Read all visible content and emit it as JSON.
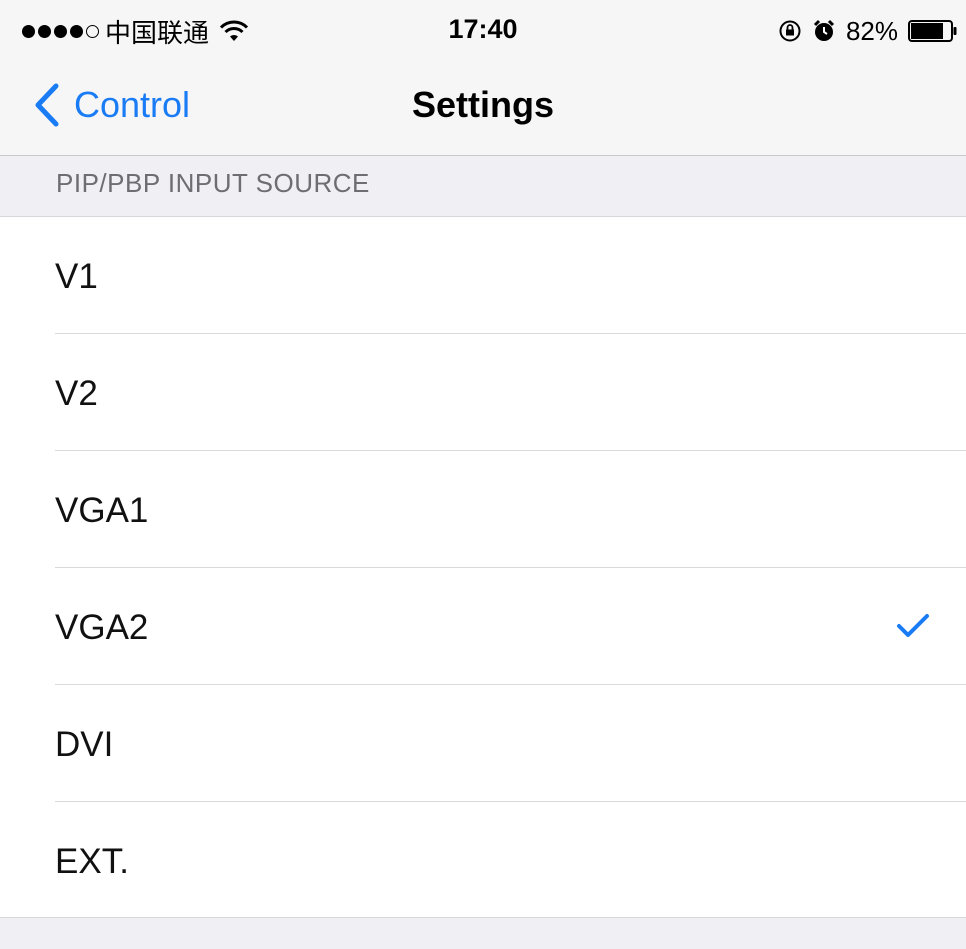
{
  "status_bar": {
    "signal_icon": "signal-dots-icon",
    "carrier": "中国联通",
    "wifi_icon": "wifi-icon",
    "time": "17:40",
    "rotation_lock_icon": "rotation-lock-icon",
    "alarm_icon": "alarm-icon",
    "battery_percent": "82%",
    "battery_icon": "battery-icon"
  },
  "navbar": {
    "back_label": "Control",
    "title": "Settings"
  },
  "section": {
    "header": "PIP/PBP INPUT SOURCE"
  },
  "options": [
    {
      "label": "V1",
      "selected": false
    },
    {
      "label": "V2",
      "selected": false
    },
    {
      "label": "VGA1",
      "selected": false
    },
    {
      "label": "VGA2",
      "selected": true
    },
    {
      "label": "DVI",
      "selected": false
    },
    {
      "label": "EXT.",
      "selected": false
    }
  ],
  "colors": {
    "accent": "#1a7cf5",
    "background": "#efeff4",
    "separator": "#d9d9dc",
    "section_text": "#6d6d72"
  }
}
